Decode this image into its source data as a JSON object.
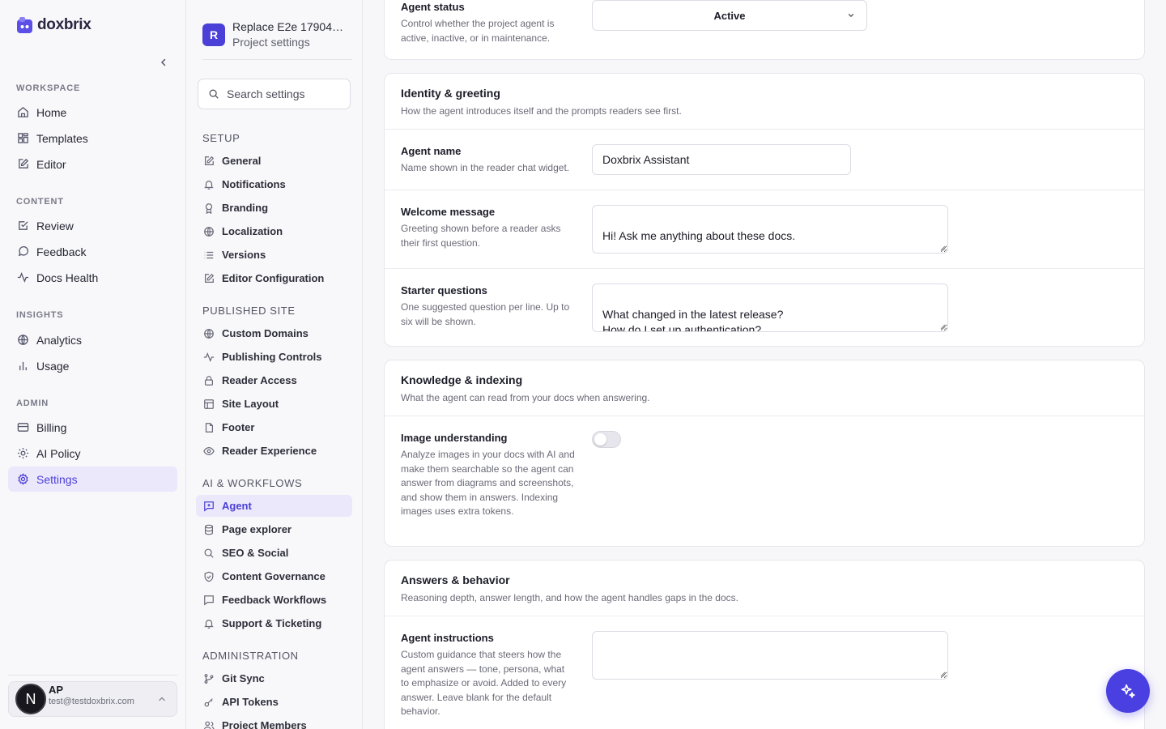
{
  "app": {
    "brand": "doxbrix"
  },
  "sidebar": {
    "sections": [
      {
        "label": "WORKSPACE",
        "items": [
          {
            "label": "Home",
            "icon": "home-icon"
          },
          {
            "label": "Templates",
            "icon": "grid-icon"
          },
          {
            "label": "Editor",
            "icon": "edit-icon"
          }
        ]
      },
      {
        "label": "CONTENT",
        "items": [
          {
            "label": "Review",
            "icon": "check-square-icon"
          },
          {
            "label": "Feedback",
            "icon": "message-circle-icon"
          },
          {
            "label": "Docs Health",
            "icon": "activity-icon"
          }
        ]
      },
      {
        "label": "INSIGHTS",
        "items": [
          {
            "label": "Analytics",
            "icon": "globe-icon"
          },
          {
            "label": "Usage",
            "icon": "bar-chart-icon"
          }
        ]
      },
      {
        "label": "ADMIN",
        "items": [
          {
            "label": "Billing",
            "icon": "credit-card-icon"
          },
          {
            "label": "AI Policy",
            "icon": "sun-icon"
          },
          {
            "label": "Settings",
            "icon": "gear-icon",
            "active": true
          }
        ]
      }
    ],
    "user": {
      "avatar_letter": "N",
      "initials": "AP",
      "email": "test@testdoxbrix.com"
    }
  },
  "panel": {
    "project": {
      "badge": "R",
      "title": "Replace E2e 1790445...",
      "subtitle": "Project settings"
    },
    "search": {
      "placeholder": "Search settings"
    },
    "sections": [
      {
        "label": "SETUP",
        "items": [
          "General",
          "Notifications",
          "Branding",
          "Localization",
          "Versions",
          "Editor Configuration"
        ]
      },
      {
        "label": "PUBLISHED SITE",
        "items": [
          "Custom Domains",
          "Publishing Controls",
          "Reader Access",
          "Site Layout",
          "Footer",
          "Reader Experience"
        ]
      },
      {
        "label": "AI & WORKFLOWS",
        "items": [
          "Agent",
          "Page explorer",
          "SEO & Social",
          "Content Governance",
          "Feedback Workflows",
          "Support & Ticketing"
        ]
      },
      {
        "label": "ADMINISTRATION",
        "items": [
          "Git Sync",
          "API Tokens",
          "Project Members"
        ]
      }
    ],
    "active_item": "Agent"
  },
  "main": {
    "status": {
      "title": "Agent status",
      "desc": "Control whether the project agent is active, inactive, or in maintenance.",
      "value": "Active"
    },
    "identity": {
      "title": "Identity & greeting",
      "desc": "How the agent introduces itself and the prompts readers see first.",
      "name": {
        "title": "Agent name",
        "desc": "Name shown in the reader chat widget.",
        "value": "Doxbrix Assistant"
      },
      "welcome": {
        "title": "Welcome message",
        "desc": "Greeting shown before a reader asks their first question.",
        "value": "Hi! Ask me anything about these docs."
      },
      "starter": {
        "title": "Starter questions",
        "desc": "One suggested question per line. Up to six will be shown.",
        "value": "What changed in the latest release?\nHow do I set up authentication?\nWhere should a first-time user start?"
      }
    },
    "knowledge": {
      "title": "Knowledge & indexing",
      "desc": "What the agent can read from your docs when answering.",
      "image": {
        "title": "Image understanding",
        "desc": "Analyze images in your docs with AI and make them searchable so the agent can answer from diagrams and screenshots, and show them in answers. Indexing images uses extra tokens.",
        "enabled": false
      }
    },
    "answers": {
      "title": "Answers & behavior",
      "desc": "Reasoning depth, answer length, and how the agent handles gaps in the docs.",
      "instructions": {
        "title": "Agent instructions",
        "desc": "Custom guidance that steers how the agent answers — tone, persona, what to emphasize or avoid. Added to every answer. Leave blank for the default behavior.",
        "value": ""
      }
    }
  },
  "colors": {
    "accent": "#4a3fd6",
    "active_bg": "#ebe8fb"
  }
}
